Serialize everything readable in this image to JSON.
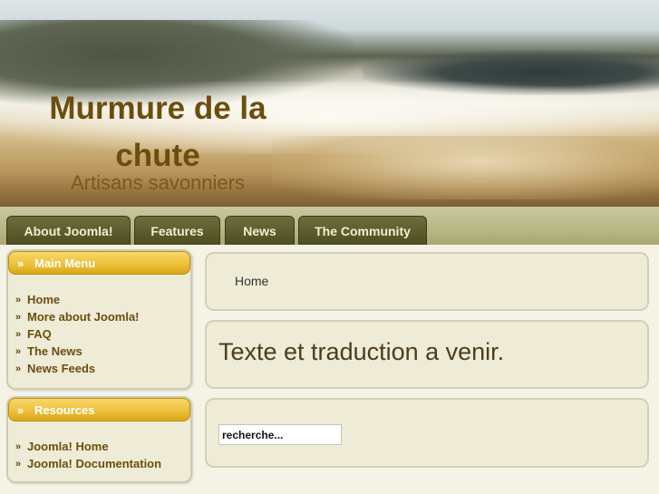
{
  "header": {
    "title": "Murmure de la chute",
    "subtitle": "Artisans savonniers"
  },
  "nav": {
    "items": [
      {
        "label": "About Joomla!"
      },
      {
        "label": "Features"
      },
      {
        "label": "News"
      },
      {
        "label": "The Community"
      }
    ]
  },
  "sidebar": {
    "main_menu": {
      "title": "Main Menu",
      "items": [
        {
          "label": "Home"
        },
        {
          "label": "More about Joomla!"
        },
        {
          "label": "FAQ"
        },
        {
          "label": "The News"
        },
        {
          "label": "News Feeds"
        }
      ]
    },
    "resources": {
      "title": "Resources",
      "items": [
        {
          "label": "Joomla! Home"
        },
        {
          "label": "Joomla! Documentation"
        }
      ]
    }
  },
  "main": {
    "breadcrumb": "Home",
    "article_title": "Texte et traduction a venir.",
    "search": {
      "value": "recherche..."
    }
  },
  "colors": {
    "accent_gold": "#eec13b",
    "nav_tab": "#4e4d24",
    "link_brown": "#6b4e0e",
    "panel_bg": "#eeebd7"
  },
  "icons": {
    "module_head": "double-chevron-right-icon",
    "menu_item": "small-chevron-right-icon"
  }
}
